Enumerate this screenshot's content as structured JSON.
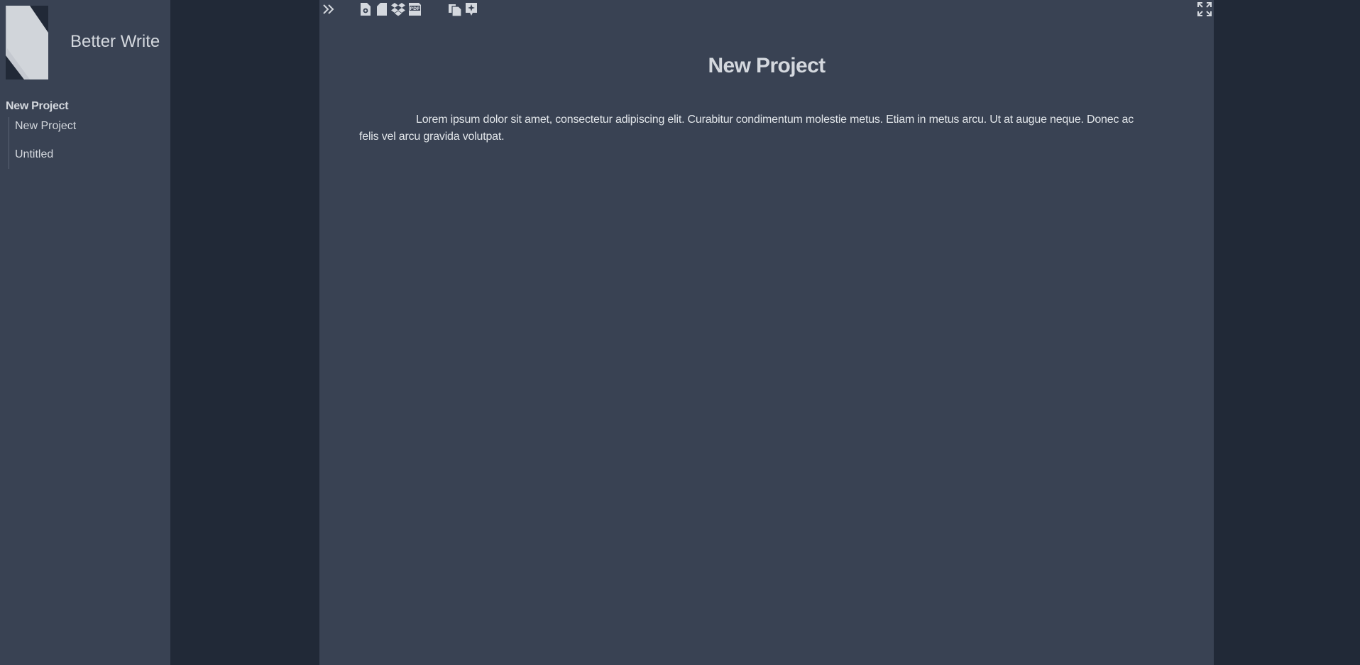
{
  "app": {
    "title": "Better Write"
  },
  "sidebar": {
    "root_label": "New Project",
    "items": [
      {
        "label": "New Project"
      },
      {
        "label": "Untitled"
      }
    ]
  },
  "toolbar": {
    "buttons": [
      {
        "icon": "chevron-double-right-icon"
      },
      {
        "icon": "file-settings-icon"
      },
      {
        "icon": "new-file-icon"
      },
      {
        "icon": "dropbox-icon"
      },
      {
        "icon": "pdf-icon"
      },
      {
        "icon": "copy-icon"
      },
      {
        "icon": "magic-insert-icon"
      },
      {
        "icon": "fullscreen-icon"
      }
    ]
  },
  "document": {
    "title": "New Project",
    "paragraph": "Lorem ipsum dolor sit amet, consectetur adipiscing elit. Curabitur condimentum molestie metus. Etiam in metus arcu. Ut at augue neque. Donec ac felis vel arcu gravida volutpat."
  },
  "colors": {
    "background": "#212937",
    "panel": "#394253",
    "text": "#d4d8de"
  }
}
